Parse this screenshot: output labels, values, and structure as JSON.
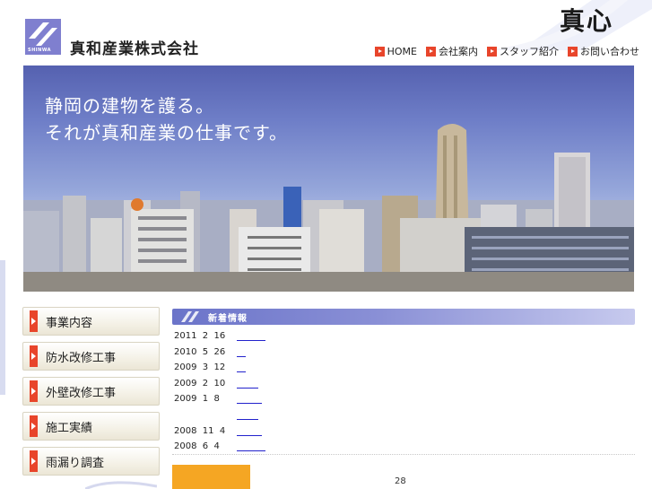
{
  "header": {
    "logo_text": "SHINWA",
    "company_name": "真和産業株式会社",
    "calligraphy": "真心",
    "nav": [
      {
        "label": "HOME"
      },
      {
        "label": "会社案内"
      },
      {
        "label": "スタッフ紹介"
      },
      {
        "label": "お問い合わせ"
      }
    ]
  },
  "hero": {
    "line1": "静岡の建物を護る。",
    "line2": "それが真和産業の仕事です。"
  },
  "sidebar": {
    "items": [
      {
        "label": "事業内容"
      },
      {
        "label": "防水改修工事"
      },
      {
        "label": "外壁改修工事"
      },
      {
        "label": "施工実績"
      },
      {
        "label": "雨漏り調査"
      }
    ]
  },
  "news": {
    "title": "新着情報",
    "rows": [
      {
        "date": "2011  2  16"
      },
      {
        "date": "2010  5  26"
      },
      {
        "date": "2009  3  12"
      },
      {
        "date": "2009  2  10"
      },
      {
        "date": "2009  1  8"
      },
      {
        "date": ""
      },
      {
        "date": "2008  11  4"
      },
      {
        "date": "2008  6  4"
      }
    ]
  },
  "footer": {
    "counter": "28"
  },
  "colors": {
    "accent_red": "#e8452b",
    "news_header": "#6b74c9",
    "logo": "#7f7fcf",
    "orange_box": "#f5a623"
  }
}
